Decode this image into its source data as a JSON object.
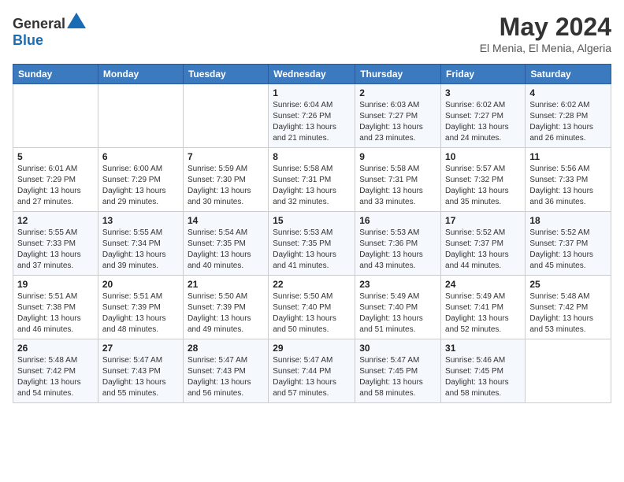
{
  "logo": {
    "text_general": "General",
    "text_blue": "Blue"
  },
  "title": {
    "month_year": "May 2024",
    "location": "El Menia, El Menia, Algeria"
  },
  "weekdays": [
    "Sunday",
    "Monday",
    "Tuesday",
    "Wednesday",
    "Thursday",
    "Friday",
    "Saturday"
  ],
  "weeks": [
    [
      {
        "day": "",
        "sunrise": "",
        "sunset": "",
        "daylight": ""
      },
      {
        "day": "",
        "sunrise": "",
        "sunset": "",
        "daylight": ""
      },
      {
        "day": "",
        "sunrise": "",
        "sunset": "",
        "daylight": ""
      },
      {
        "day": "1",
        "sunrise": "Sunrise: 6:04 AM",
        "sunset": "Sunset: 7:26 PM",
        "daylight": "Daylight: 13 hours and 21 minutes."
      },
      {
        "day": "2",
        "sunrise": "Sunrise: 6:03 AM",
        "sunset": "Sunset: 7:27 PM",
        "daylight": "Daylight: 13 hours and 23 minutes."
      },
      {
        "day": "3",
        "sunrise": "Sunrise: 6:02 AM",
        "sunset": "Sunset: 7:27 PM",
        "daylight": "Daylight: 13 hours and 24 minutes."
      },
      {
        "day": "4",
        "sunrise": "Sunrise: 6:02 AM",
        "sunset": "Sunset: 7:28 PM",
        "daylight": "Daylight: 13 hours and 26 minutes."
      }
    ],
    [
      {
        "day": "5",
        "sunrise": "Sunrise: 6:01 AM",
        "sunset": "Sunset: 7:29 PM",
        "daylight": "Daylight: 13 hours and 27 minutes."
      },
      {
        "day": "6",
        "sunrise": "Sunrise: 6:00 AM",
        "sunset": "Sunset: 7:29 PM",
        "daylight": "Daylight: 13 hours and 29 minutes."
      },
      {
        "day": "7",
        "sunrise": "Sunrise: 5:59 AM",
        "sunset": "Sunset: 7:30 PM",
        "daylight": "Daylight: 13 hours and 30 minutes."
      },
      {
        "day": "8",
        "sunrise": "Sunrise: 5:58 AM",
        "sunset": "Sunset: 7:31 PM",
        "daylight": "Daylight: 13 hours and 32 minutes."
      },
      {
        "day": "9",
        "sunrise": "Sunrise: 5:58 AM",
        "sunset": "Sunset: 7:31 PM",
        "daylight": "Daylight: 13 hours and 33 minutes."
      },
      {
        "day": "10",
        "sunrise": "Sunrise: 5:57 AM",
        "sunset": "Sunset: 7:32 PM",
        "daylight": "Daylight: 13 hours and 35 minutes."
      },
      {
        "day": "11",
        "sunrise": "Sunrise: 5:56 AM",
        "sunset": "Sunset: 7:33 PM",
        "daylight": "Daylight: 13 hours and 36 minutes."
      }
    ],
    [
      {
        "day": "12",
        "sunrise": "Sunrise: 5:55 AM",
        "sunset": "Sunset: 7:33 PM",
        "daylight": "Daylight: 13 hours and 37 minutes."
      },
      {
        "day": "13",
        "sunrise": "Sunrise: 5:55 AM",
        "sunset": "Sunset: 7:34 PM",
        "daylight": "Daylight: 13 hours and 39 minutes."
      },
      {
        "day": "14",
        "sunrise": "Sunrise: 5:54 AM",
        "sunset": "Sunset: 7:35 PM",
        "daylight": "Daylight: 13 hours and 40 minutes."
      },
      {
        "day": "15",
        "sunrise": "Sunrise: 5:53 AM",
        "sunset": "Sunset: 7:35 PM",
        "daylight": "Daylight: 13 hours and 41 minutes."
      },
      {
        "day": "16",
        "sunrise": "Sunrise: 5:53 AM",
        "sunset": "Sunset: 7:36 PM",
        "daylight": "Daylight: 13 hours and 43 minutes."
      },
      {
        "day": "17",
        "sunrise": "Sunrise: 5:52 AM",
        "sunset": "Sunset: 7:37 PM",
        "daylight": "Daylight: 13 hours and 44 minutes."
      },
      {
        "day": "18",
        "sunrise": "Sunrise: 5:52 AM",
        "sunset": "Sunset: 7:37 PM",
        "daylight": "Daylight: 13 hours and 45 minutes."
      }
    ],
    [
      {
        "day": "19",
        "sunrise": "Sunrise: 5:51 AM",
        "sunset": "Sunset: 7:38 PM",
        "daylight": "Daylight: 13 hours and 46 minutes."
      },
      {
        "day": "20",
        "sunrise": "Sunrise: 5:51 AM",
        "sunset": "Sunset: 7:39 PM",
        "daylight": "Daylight: 13 hours and 48 minutes."
      },
      {
        "day": "21",
        "sunrise": "Sunrise: 5:50 AM",
        "sunset": "Sunset: 7:39 PM",
        "daylight": "Daylight: 13 hours and 49 minutes."
      },
      {
        "day": "22",
        "sunrise": "Sunrise: 5:50 AM",
        "sunset": "Sunset: 7:40 PM",
        "daylight": "Daylight: 13 hours and 50 minutes."
      },
      {
        "day": "23",
        "sunrise": "Sunrise: 5:49 AM",
        "sunset": "Sunset: 7:40 PM",
        "daylight": "Daylight: 13 hours and 51 minutes."
      },
      {
        "day": "24",
        "sunrise": "Sunrise: 5:49 AM",
        "sunset": "Sunset: 7:41 PM",
        "daylight": "Daylight: 13 hours and 52 minutes."
      },
      {
        "day": "25",
        "sunrise": "Sunrise: 5:48 AM",
        "sunset": "Sunset: 7:42 PM",
        "daylight": "Daylight: 13 hours and 53 minutes."
      }
    ],
    [
      {
        "day": "26",
        "sunrise": "Sunrise: 5:48 AM",
        "sunset": "Sunset: 7:42 PM",
        "daylight": "Daylight: 13 hours and 54 minutes."
      },
      {
        "day": "27",
        "sunrise": "Sunrise: 5:47 AM",
        "sunset": "Sunset: 7:43 PM",
        "daylight": "Daylight: 13 hours and 55 minutes."
      },
      {
        "day": "28",
        "sunrise": "Sunrise: 5:47 AM",
        "sunset": "Sunset: 7:43 PM",
        "daylight": "Daylight: 13 hours and 56 minutes."
      },
      {
        "day": "29",
        "sunrise": "Sunrise: 5:47 AM",
        "sunset": "Sunset: 7:44 PM",
        "daylight": "Daylight: 13 hours and 57 minutes."
      },
      {
        "day": "30",
        "sunrise": "Sunrise: 5:47 AM",
        "sunset": "Sunset: 7:45 PM",
        "daylight": "Daylight: 13 hours and 58 minutes."
      },
      {
        "day": "31",
        "sunrise": "Sunrise: 5:46 AM",
        "sunset": "Sunset: 7:45 PM",
        "daylight": "Daylight: 13 hours and 58 minutes."
      },
      {
        "day": "",
        "sunrise": "",
        "sunset": "",
        "daylight": ""
      }
    ]
  ]
}
